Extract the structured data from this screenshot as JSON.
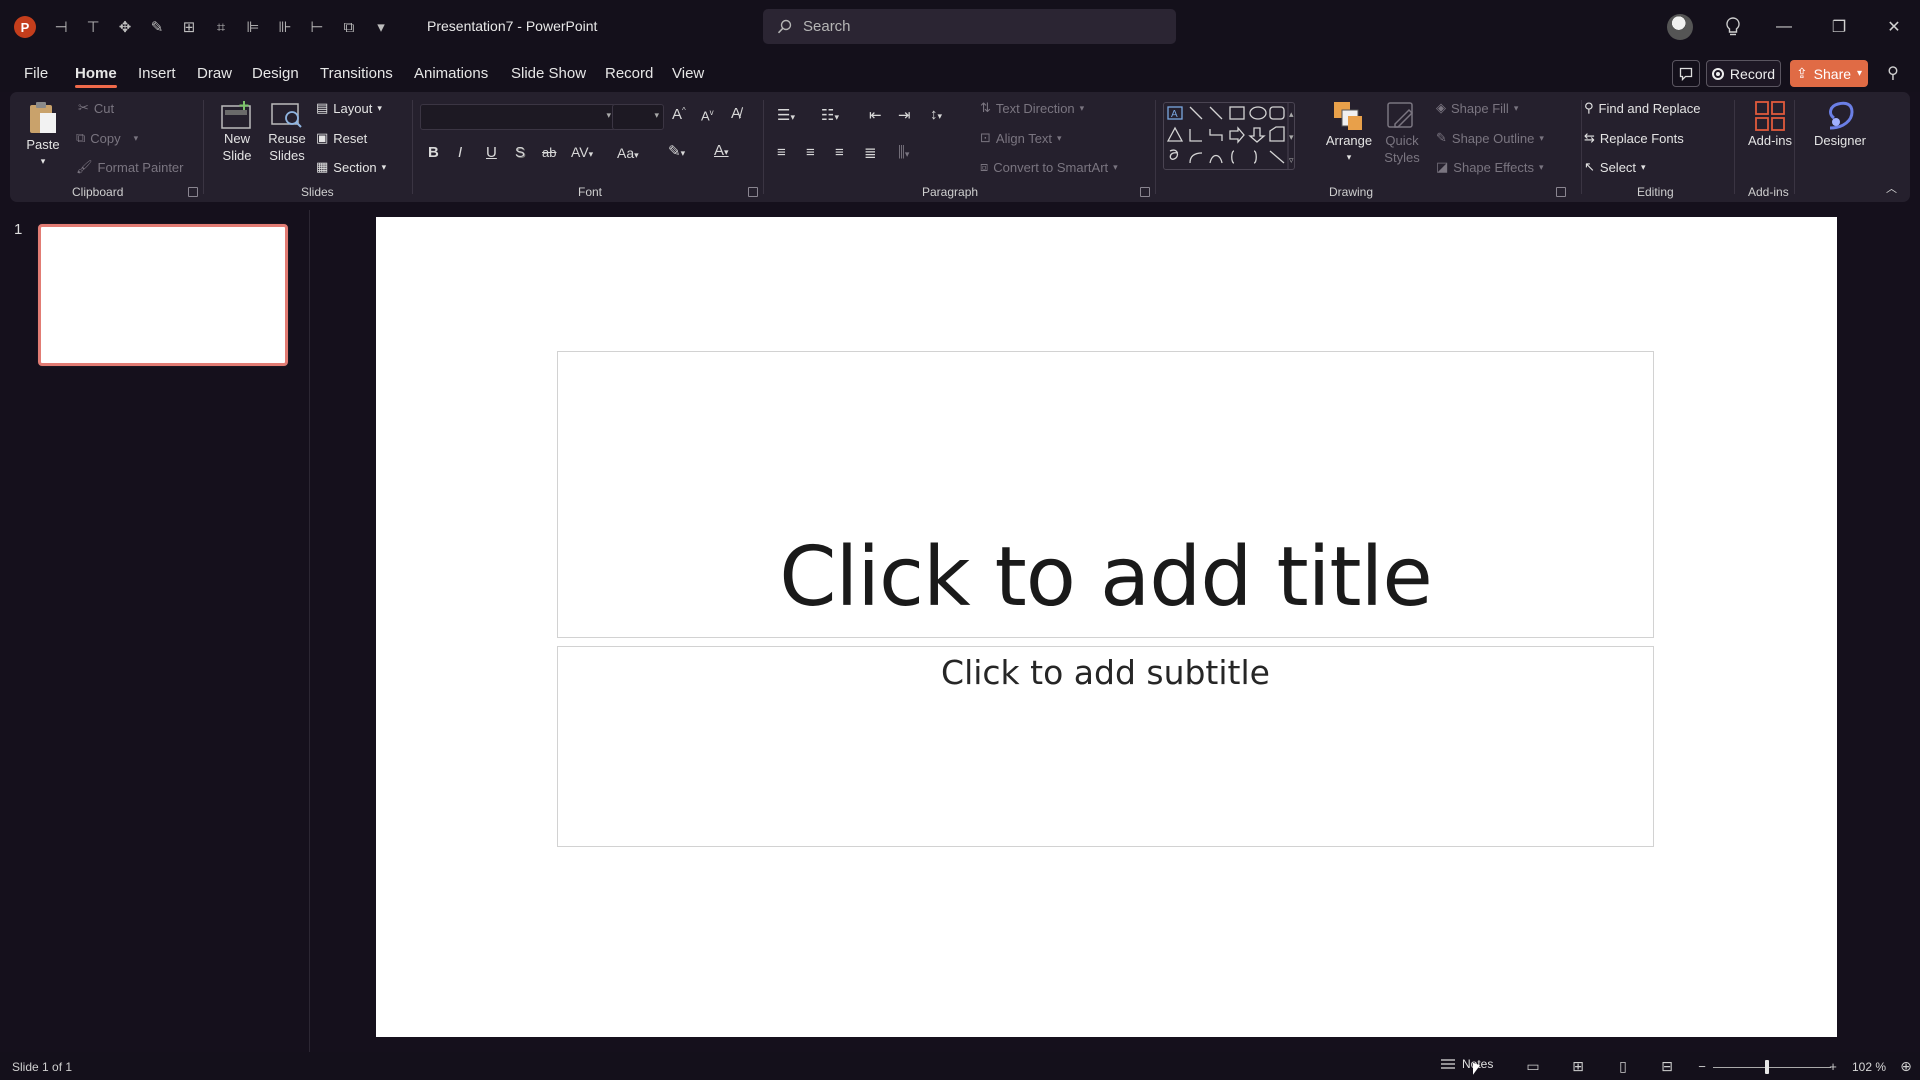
{
  "app": {
    "title": "Presentation7  -  PowerPoint",
    "logo_letter": "P"
  },
  "search": {
    "placeholder": "Search"
  },
  "menu": {
    "tabs": [
      "File",
      "Home",
      "Insert",
      "Draw",
      "Design",
      "Transitions",
      "Animations",
      "Slide Show",
      "Record",
      "View"
    ],
    "active_tab": "Home",
    "record_label": "Record",
    "share_label": "Share"
  },
  "ribbon": {
    "clipboard": {
      "label": "Clipboard",
      "paste": "Paste",
      "cut": "Cut",
      "copy": "Copy",
      "format_painter": "Format Painter"
    },
    "slides": {
      "label": "Slides",
      "new_slide": "New Slide",
      "reuse_slides": "Reuse Slides",
      "layout": "Layout",
      "reset": "Reset",
      "section": "Section"
    },
    "font": {
      "label": "Font",
      "bold": "B",
      "italic": "I",
      "underline": "U",
      "shadow": "S",
      "strike": "ab",
      "spacing": "AV",
      "case": "Aa",
      "grow": "A",
      "shrink": "A"
    },
    "paragraph": {
      "label": "Paragraph",
      "text_direction": "Text Direction",
      "align_text": "Align Text",
      "convert_smartart": "Convert to SmartArt"
    },
    "drawing": {
      "label": "Drawing",
      "arrange": "Arrange",
      "quick_styles": "Quick Styles",
      "shape_fill": "Shape Fill",
      "shape_outline": "Shape Outline",
      "shape_effects": "Shape Effects"
    },
    "editing": {
      "label": "Editing",
      "find_replace": "Find and Replace",
      "replace_fonts": "Replace Fonts",
      "select": "Select"
    },
    "addins": {
      "label": "Add-ins",
      "addins": "Add-ins",
      "designer": "Designer"
    }
  },
  "slides_panel": {
    "slide_number": "1"
  },
  "slide": {
    "title_placeholder": "Click to add title",
    "subtitle_placeholder": "Click to add subtitle"
  },
  "status": {
    "slide_count": "Slide 1 of 1",
    "notes": "Notes",
    "zoom": "102 %",
    "zoom_value": 102
  },
  "colors": {
    "accent": "#f06a4b",
    "share": "#e06b45",
    "app_logo": "#c43e1c",
    "thumb_border": "#e27c74"
  }
}
